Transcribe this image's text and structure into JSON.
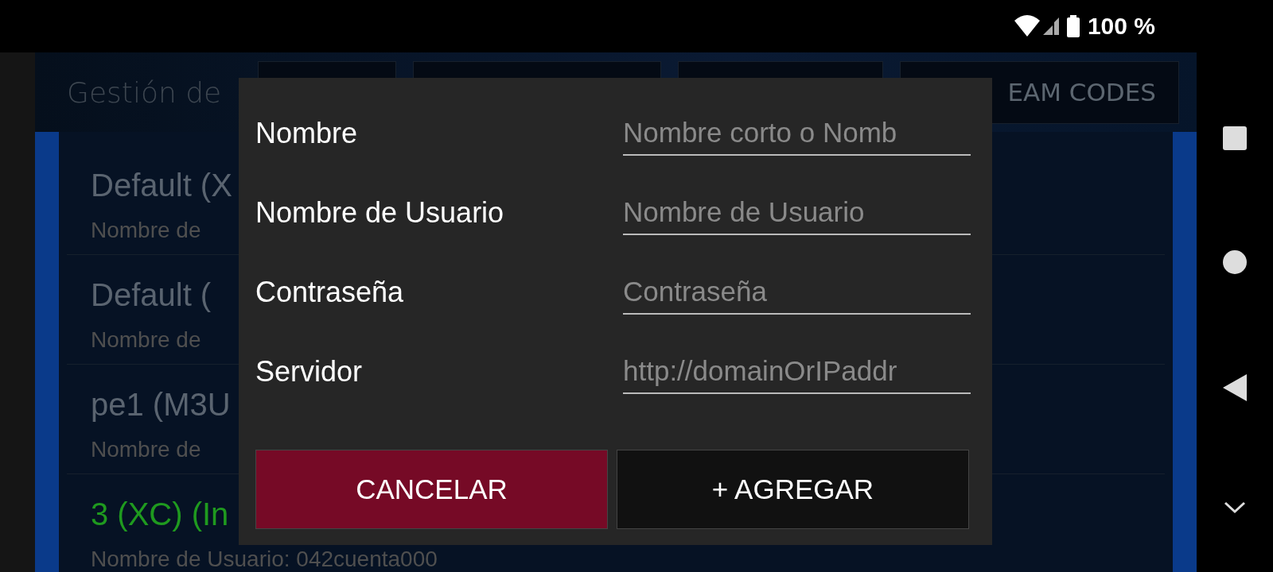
{
  "status_bar": {
    "battery_text": "100 %"
  },
  "header": {
    "title": "Gestión de",
    "tabs": [
      {
        "label": "EAM CODES"
      }
    ]
  },
  "list": [
    {
      "title": "Default (X",
      "subtitle": "Nombre de",
      "highlight": false
    },
    {
      "title": "Default (",
      "subtitle": "Nombre de",
      "highlight": false
    },
    {
      "title": "pe1 (M3U",
      "subtitle": "Nombre de",
      "highlight": false
    },
    {
      "title": "3 (XC) (In",
      "subtitle": "Nombre de Usuario: 042cuenta000",
      "highlight": true
    }
  ],
  "dialog": {
    "fields": [
      {
        "label": "Nombre",
        "placeholder": "Nombre corto o Nomb"
      },
      {
        "label": "Nombre de Usuario",
        "placeholder": "Nombre de Usuario"
      },
      {
        "label": "Contraseña",
        "placeholder": "Contraseña"
      },
      {
        "label": "Servidor",
        "placeholder": "http://domainOrIPaddr"
      }
    ],
    "buttons": [
      {
        "label": "CANCELAR",
        "kind": "cancel"
      },
      {
        "label": "+ AGREGAR",
        "kind": "add"
      }
    ]
  }
}
